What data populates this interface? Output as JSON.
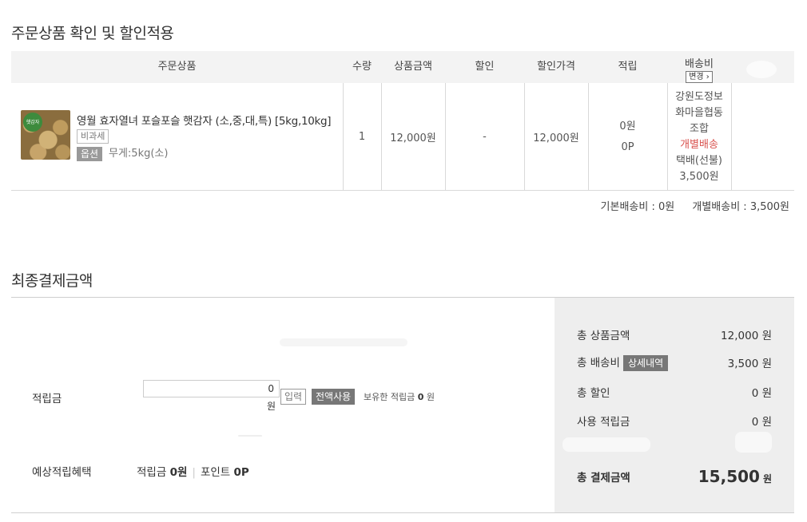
{
  "order_section": {
    "title": "주문상품 확인 및 할인적용",
    "headers": {
      "product": "주문상품",
      "qty": "수량",
      "price": "상품금액",
      "discount": "할인",
      "discount_price": "할인가격",
      "reward": "적립",
      "shipping": "배송비",
      "shipping_change_button": "변경 ›"
    },
    "item": {
      "thumb_badge": "햇감자",
      "name": "영월 효자열녀 포슬포슬 햇감자 (소,중,대,특) [5kg,10kg]",
      "tax_badge": "비과세",
      "option_badge": "옵션",
      "option_text": "무게:5kg(소)",
      "qty": "1",
      "price": "12,000원",
      "discount": "-",
      "discount_price": "12,000원",
      "reward_won": "0원",
      "reward_point": "0P",
      "shipping": {
        "seller_line1": "강원도정보",
        "seller_line2": "화마을협동",
        "seller_line3": "조합",
        "type": "개별배송",
        "method": "택배(선불)",
        "fee": "3,500원"
      }
    },
    "summary": {
      "base_shipping": "기본배송비 : 0원",
      "individual_shipping": "개별배송비 : 3,500원"
    }
  },
  "final_section": {
    "title": "최종결제금액",
    "points": {
      "label": "적립금",
      "input_value": "0",
      "unit": "원",
      "input_button": "입력",
      "use_all_button": "전액사용",
      "hold_prefix": "보유한 적립금",
      "hold_amount": "0",
      "hold_unit": "원"
    },
    "benefit": {
      "label": "예상적립혜택",
      "points_label": "적립금",
      "points_value": "0원",
      "point_label": "포인트",
      "point_value": "0P"
    },
    "panel": {
      "total_product_label": "총 상품금액",
      "total_product_value": "12,000 원",
      "total_shipping_label": "총 배송비",
      "detail_button": "상세내역",
      "total_shipping_value": "3,500 원",
      "total_discount_label": "총 할인",
      "total_discount_value": "0 원",
      "used_points_label": "사용 적립금",
      "used_points_value": "0 원",
      "grand_total_label": "총 결제금액",
      "grand_total_value": "15,500",
      "grand_total_unit": "원"
    }
  }
}
